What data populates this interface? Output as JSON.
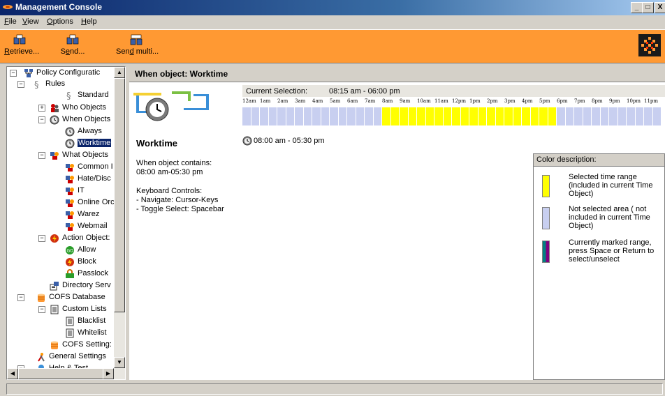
{
  "window": {
    "title": "Management Console"
  },
  "menu": [
    {
      "label": "File",
      "key": "F",
      "rest": "ile"
    },
    {
      "label": "View",
      "key": "V",
      "rest": "iew"
    },
    {
      "label": "Options",
      "key": "O",
      "rest": "ptions"
    },
    {
      "label": "Help",
      "key": "H",
      "rest": "elp"
    }
  ],
  "toolbar": {
    "retrieve_key": "R",
    "retrieve_rest": "etrieve...",
    "send_pre": "S",
    "send_key": "e",
    "send_rest": "nd...",
    "sendmulti_pre": "Sen",
    "sendmulti_key": "d",
    "sendmulti_rest": " multi..."
  },
  "tree": {
    "policy": "Policy Configuratic",
    "rules": "Rules",
    "standard": "Standard",
    "who": "Who Objects",
    "when": "When Objects",
    "always": "Always",
    "worktime": "Worktime",
    "what": "What Objects",
    "common": "Common I",
    "hate": "Hate/Disc",
    "it": "IT",
    "online": "Online Orc",
    "warez": "Warez",
    "webmail": "Webmail",
    "action": "Action Object:",
    "allow": "Allow",
    "block": "Block",
    "passlock": "Passlock",
    "directory": "Directory Serv",
    "cofs_db": "COFS Database",
    "custom_lists": "Custom Lists",
    "blacklist": "Blacklist",
    "whitelist": "Whitelist",
    "cofs_settings": "COFS Setting:",
    "general": "General Settings",
    "help": "Help & Test"
  },
  "main": {
    "header": "When object: Worktime",
    "current_selection_label": "Current Selection:",
    "current_selection_value": "08:15 am - 06:00 pm",
    "hours": [
      "12am",
      "1am",
      "2am",
      "3am",
      "4am",
      "5am",
      "6am",
      "7am",
      "8am",
      "9am",
      "10am",
      "11am",
      "12pm",
      "1pm",
      "2pm",
      "3pm",
      "4pm",
      "5pm",
      "6pm",
      "7pm",
      "8pm",
      "9pm",
      "10pm",
      "11pm"
    ],
    "selected_range": {
      "start_hour": 8.25,
      "end_hour": 18.0
    },
    "marked_range": {
      "start_hour": 8.0,
      "end_hour": 17.5
    },
    "object_name": "Worktime",
    "contains_label": "When object contains:",
    "contains_value": "08:00 am-05:30 pm",
    "keyboard_label": "Keyboard Controls:",
    "keyboard_nav": "- Navigate: Cursor-Keys",
    "keyboard_toggle": "- Toggle Select: Spacebar",
    "time_range": "08:00 am - 05:30 pm"
  },
  "color_desc": {
    "title": "Color description:",
    "items": [
      {
        "line1": "Selected time range",
        "line2": "(included in current Time",
        "line3": "Object)"
      },
      {
        "line1": "Not selected area ( not",
        "line2": "included in current Time",
        "line3": "Object)"
      },
      {
        "line1": "Currently marked range,",
        "line2": "press Space or  Return to",
        "line3": "select/unselect"
      }
    ]
  },
  "colors": {
    "selected": "#ffff00",
    "not_selected": "#c8cff0",
    "marked_left": "#008080",
    "marked_right": "#800080",
    "toolbar": "#ff9933",
    "title_bar": "#0a246a"
  }
}
